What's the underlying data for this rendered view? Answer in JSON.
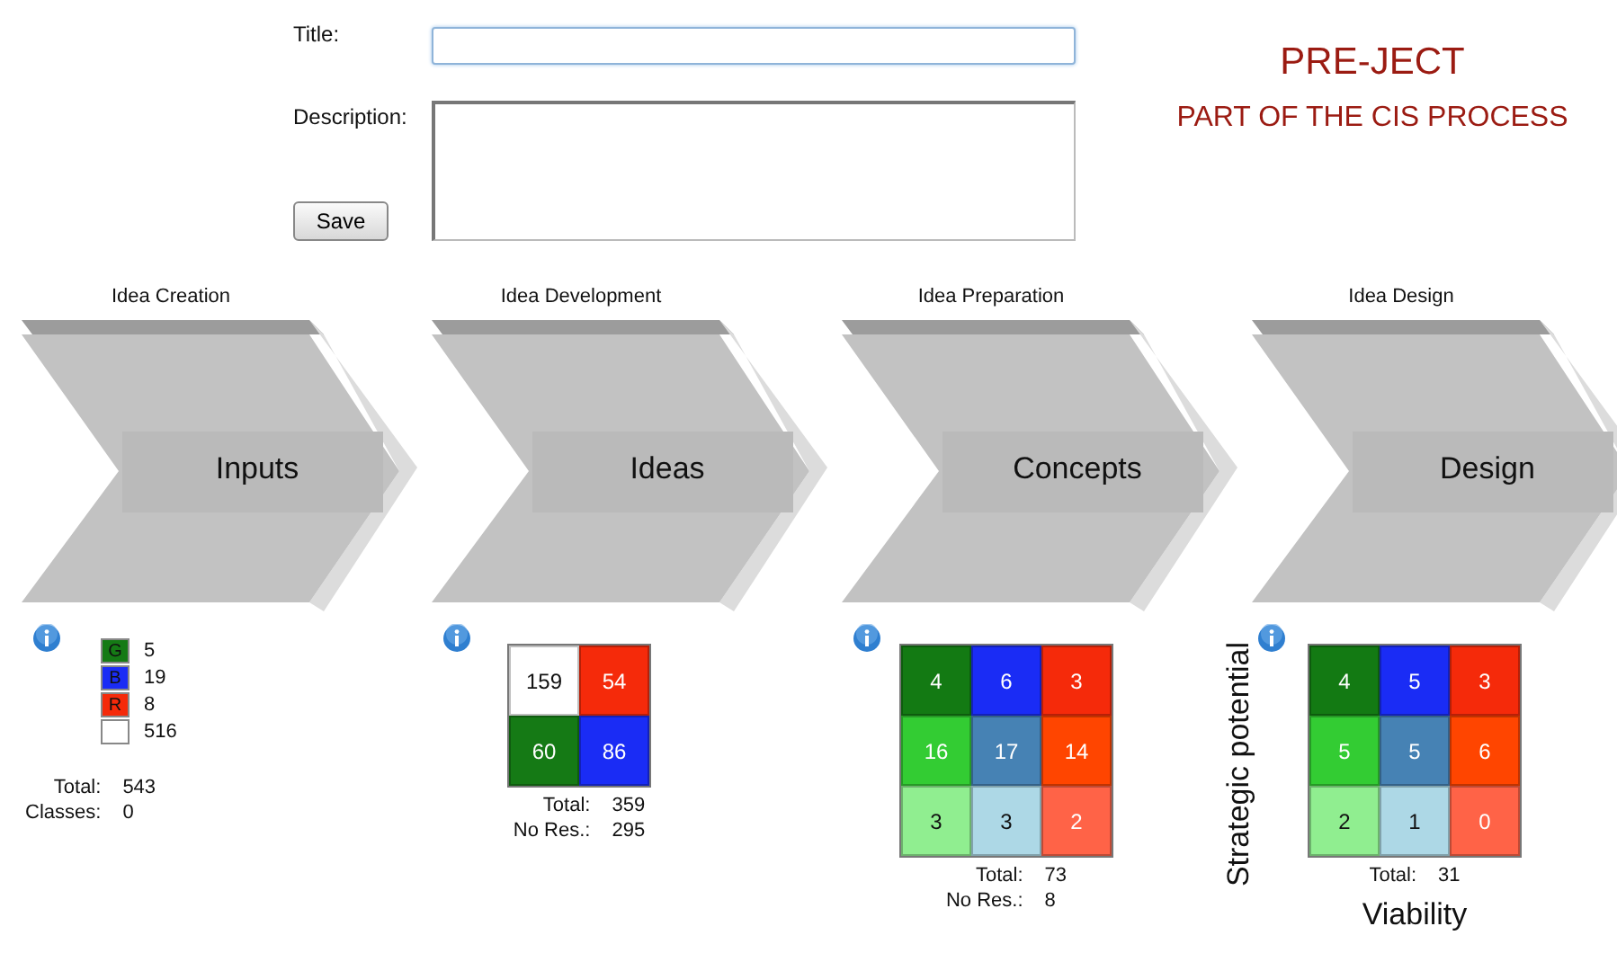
{
  "form": {
    "title_label": "Title:",
    "description_label": "Description:",
    "save_button": "Save"
  },
  "brand": {
    "title": "PRE-JECT",
    "subtitle": "PART OF THE CIS PROCESS"
  },
  "stages": [
    {
      "heading": "Idea Creation",
      "arrow_label": "Inputs",
      "panel": {
        "kind": "legend",
        "items": [
          {
            "letter": "G",
            "color": "#157a15",
            "count": "5"
          },
          {
            "letter": "B",
            "color": "#1a2cf5",
            "count": "19"
          },
          {
            "letter": "R",
            "color": "#f52a0a",
            "count": "8"
          },
          {
            "color": "#ffffff",
            "count": "516"
          }
        ],
        "stats": [
          {
            "label": "Total:",
            "value": "543"
          },
          {
            "label": "Classes:",
            "value": "0"
          }
        ]
      }
    },
    {
      "heading": "Idea Development",
      "arrow_label": "Ideas",
      "panel": {
        "kind": "grid",
        "rows": [
          [
            {
              "value": "159",
              "color": "#ffffff"
            },
            {
              "value": "54",
              "color": "#f52a0a"
            }
          ],
          [
            {
              "value": "60",
              "color": "#157a15"
            },
            {
              "value": "86",
              "color": "#1a2cf5"
            }
          ]
        ],
        "stats": [
          {
            "label": "Total:",
            "value": "359"
          },
          {
            "label": "No Res.:",
            "value": "295"
          }
        ]
      }
    },
    {
      "heading": "Idea Preparation",
      "arrow_label": "Concepts",
      "panel": {
        "kind": "grid",
        "rows": [
          [
            {
              "value": "4",
              "color": "#137a13"
            },
            {
              "value": "6",
              "color": "#1a2cf5"
            },
            {
              "value": "3",
              "color": "#f52a0a"
            }
          ],
          [
            {
              "value": "16",
              "color": "#33cc33"
            },
            {
              "value": "17",
              "color": "#4682b4"
            },
            {
              "value": "14",
              "color": "#ff4500"
            }
          ],
          [
            {
              "value": "3",
              "color": "#90ee90"
            },
            {
              "value": "3",
              "color": "#add8e6"
            },
            {
              "value": "2",
              "color": "#ff6347"
            }
          ]
        ],
        "stats": [
          {
            "label": "Total:",
            "value": "73"
          },
          {
            "label": "No Res.:",
            "value": "8"
          }
        ]
      }
    },
    {
      "heading": "Idea Design",
      "arrow_label": "Design",
      "panel": {
        "kind": "matrix",
        "y_axis": "Strategic potential",
        "x_axis": "Viability",
        "rows": [
          [
            {
              "value": "4",
              "color": "#137a13"
            },
            {
              "value": "5",
              "color": "#1a2cf5"
            },
            {
              "value": "3",
              "color": "#f52a0a"
            }
          ],
          [
            {
              "value": "5",
              "color": "#33cc33"
            },
            {
              "value": "5",
              "color": "#4682b4"
            },
            {
              "value": "6",
              "color": "#ff4500"
            }
          ],
          [
            {
              "value": "2",
              "color": "#90ee90"
            },
            {
              "value": "1",
              "color": "#add8e6"
            },
            {
              "value": "0",
              "color": "#ff6347"
            }
          ]
        ],
        "stats": [
          {
            "label": "Total:",
            "value": "31"
          }
        ]
      }
    }
  ]
}
